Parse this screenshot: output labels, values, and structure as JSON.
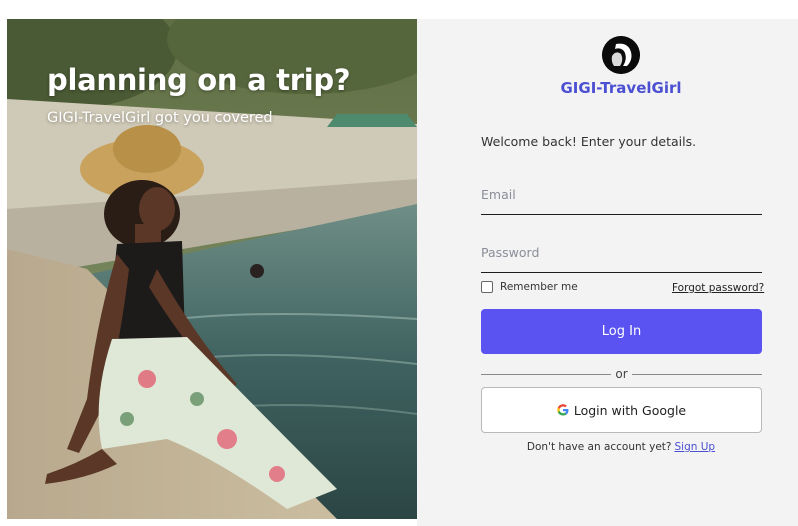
{
  "hero": {
    "title": "planning on a trip?",
    "subtitle": "GIGI-TravelGirl got you covered"
  },
  "brand": {
    "name": "GIGI-TravelGirl",
    "accent_color": "#4b4fd1"
  },
  "form": {
    "welcome": "Welcome back! Enter your details.",
    "email_placeholder": "Email",
    "email_value": "",
    "password_placeholder": "Password",
    "password_value": "",
    "remember_label": "Remember me",
    "remember_checked": false,
    "forgot_label": "Forgot password?",
    "login_label": "Log In",
    "login_color": "#5a53f2",
    "or_label": "or",
    "google_label": "Login with Google",
    "google_icon": "google-g-icon",
    "signup_prompt": "Don't have an account yet?",
    "signup_label": "Sign Up"
  }
}
